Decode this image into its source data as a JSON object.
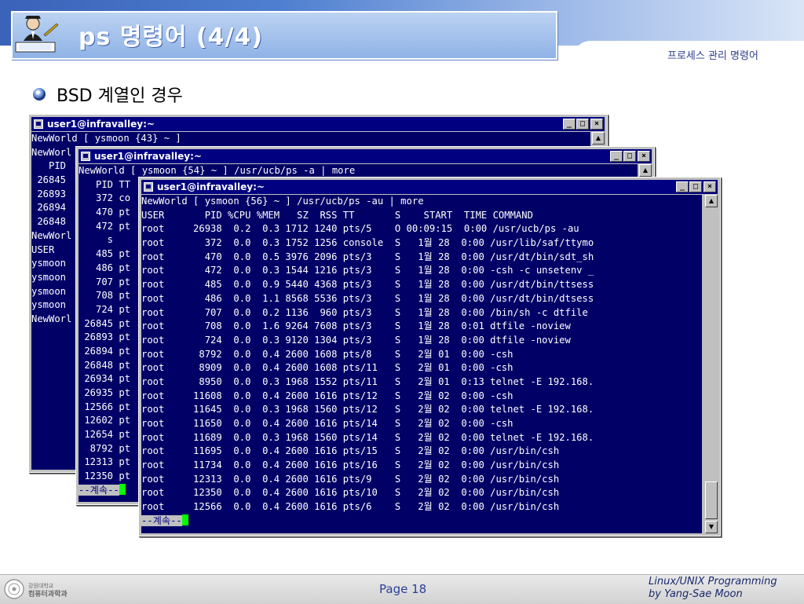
{
  "header": {
    "title": "ps 명령어 (4/4)",
    "section": "프로세스 관리 명령어"
  },
  "bullet": "BSD 계열인 경우",
  "windows": [
    {
      "title": "user1@infravalley:~",
      "lines": [
        "NewWorld [ ysmoon {43} ~ ]",
        "NewWorl",
        "   PID ",
        " 26845 ",
        " 26893 ",
        " 26894 ",
        " 26848 ",
        "NewWorl",
        "USER   ",
        "ysmoon ",
        "ysmoon ",
        "ysmoon ",
        "ysmoon ",
        "NewWorl"
      ]
    },
    {
      "title": "user1@infravalley:~",
      "lines": [
        "NewWorld [ ysmoon {54} ~ ] /usr/ucb/ps -a | more",
        "   PID TT",
        "   372 co",
        "   470 pt",
        "   472 pt",
        "     s",
        "   485 pt",
        "   486 pt",
        "   707 pt",
        "   708 pt",
        "   724 pt",
        " 26845 pt",
        " 26893 pt",
        " 26894 pt",
        " 26848 pt",
        " 26934 pt",
        " 26935 pt",
        " 12566 pt",
        " 12602 pt",
        " 12654 pt",
        "  8792 pt",
        " 12313 pt",
        " 12350 pt"
      ],
      "more": "--계속--"
    },
    {
      "title": "user1@infravalley:~",
      "lines": [
        "NewWorld [ ysmoon {56} ~ ] /usr/ucb/ps -au | more",
        "USER       PID %CPU %MEM   SZ  RSS TT       S    START  TIME COMMAND",
        "root     26938  0.2  0.3 1712 1240 pts/5    O 00:09:15  0:00 /usr/ucb/ps -au",
        "root       372  0.0  0.3 1752 1256 console  S   1월 28  0:00 /usr/lib/saf/ttymo",
        "root       470  0.0  0.5 3976 2096 pts/3    S   1월 28  0:00 /usr/dt/bin/sdt_sh",
        "root       472  0.0  0.3 1544 1216 pts/3    S   1월 28  0:00 -csh -c unsetenv _",
        "root       485  0.0  0.9 5440 4368 pts/3    S   1월 28  0:00 /usr/dt/bin/ttsess",
        "root       486  0.0  1.1 8568 5536 pts/3    S   1월 28  0:00 /usr/dt/bin/dtsess",
        "root       707  0.0  0.2 1136  960 pts/3    S   1월 28  0:00 /bin/sh -c dtfile",
        "root       708  0.0  1.6 9264 7608 pts/3    S   1월 28  0:01 dtfile -noview",
        "root       724  0.0  0.3 9120 1304 pts/3    S   1월 28  0:00 dtfile -noview",
        "root      8792  0.0  0.4 2600 1608 pts/8    S   2월 01  0:00 -csh",
        "root      8909  0.0  0.4 2600 1608 pts/11   S   2월 01  0:00 -csh",
        "root      8950  0.0  0.3 1968 1552 pts/11   S   2월 01  0:13 telnet -E 192.168.",
        "root     11608  0.0  0.4 2600 1616 pts/12   S   2월 02  0:00 -csh",
        "root     11645  0.0  0.3 1968 1560 pts/12   S   2월 02  0:00 telnet -E 192.168.",
        "root     11650  0.0  0.4 2600 1616 pts/14   S   2월 02  0:00 -csh",
        "root     11689  0.0  0.3 1968 1560 pts/14   S   2월 02  0:00 telnet -E 192.168.",
        "root     11695  0.0  0.4 2600 1616 pts/15   S   2월 02  0:00 /usr/bin/csh",
        "root     11734  0.0  0.4 2600 1616 pts/16   S   2월 02  0:00 /usr/bin/csh",
        "root     12313  0.0  0.4 2600 1616 pts/9    S   2월 02  0:00 /usr/bin/csh",
        "root     12350  0.0  0.4 2600 1616 pts/10   S   2월 02  0:00 /usr/bin/csh",
        "root     12566  0.0  0.4 2600 1616 pts/6    S   2월 02  0:00 /usr/bin/csh"
      ],
      "more": "--계속--"
    }
  ],
  "footer": {
    "page": "Page 18",
    "course_line1": "Linux/UNIX Programming",
    "course_line2": "by Yang-Sae Moon",
    "logo_line1": "강원대학교",
    "logo_line2": "컴퓨터과학과"
  },
  "colors": {
    "terminal_bg": "#000066",
    "titlebar": "#000080",
    "cursor": "#00ff00",
    "header_blue": "#4f7fd0"
  }
}
